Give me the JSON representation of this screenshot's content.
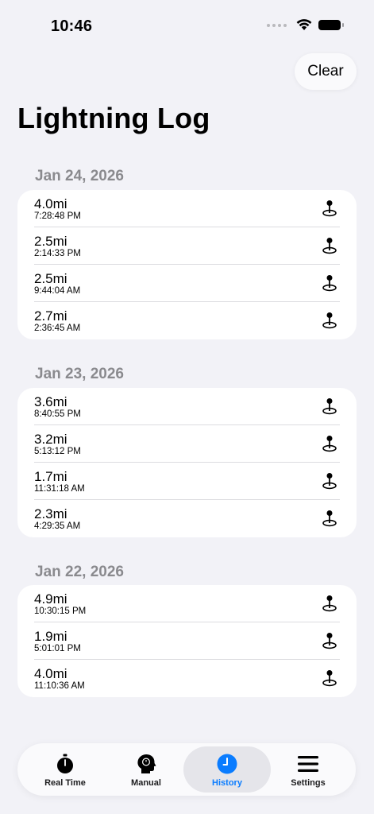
{
  "status_bar": {
    "time": "10:46"
  },
  "header": {
    "clear_label": "Clear",
    "title": "Lightning Log"
  },
  "sections": [
    {
      "date": "Jan 24, 2026",
      "entries": [
        {
          "distance": "4.0mi",
          "time": "7:28:48 PM"
        },
        {
          "distance": "2.5mi",
          "time": "2:14:33 PM"
        },
        {
          "distance": "2.5mi",
          "time": "9:44:04 AM"
        },
        {
          "distance": "2.7mi",
          "time": "2:36:45 AM"
        }
      ]
    },
    {
      "date": "Jan 23, 2026",
      "entries": [
        {
          "distance": "3.6mi",
          "time": "8:40:55 PM"
        },
        {
          "distance": "3.2mi",
          "time": "5:13:12 PM"
        },
        {
          "distance": "1.7mi",
          "time": "11:31:18 AM"
        },
        {
          "distance": "2.3mi",
          "time": "4:29:35 AM"
        }
      ]
    },
    {
      "date": "Jan 22, 2026",
      "entries": [
        {
          "distance": "4.9mi",
          "time": "10:30:15 PM"
        },
        {
          "distance": "1.9mi",
          "time": "5:01:01 PM"
        },
        {
          "distance": "4.0mi",
          "time": "11:10:36 AM"
        }
      ]
    }
  ],
  "tab_bar": {
    "tabs": [
      {
        "label": "Real Time",
        "icon": "stopwatch-icon"
      },
      {
        "label": "Manual",
        "icon": "head-profile-icon"
      },
      {
        "label": "History",
        "icon": "clock-icon",
        "active": true
      },
      {
        "label": "Settings",
        "icon": "menu-lines-icon"
      }
    ],
    "active_color": "#0a7cff"
  }
}
